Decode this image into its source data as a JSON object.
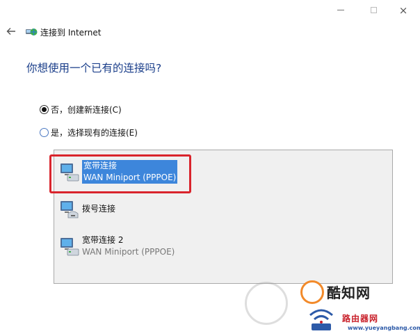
{
  "window": {
    "title": "连接到 Internet",
    "controls": {
      "minimize": "minimize-icon",
      "maximize": "maximize-icon",
      "close": "×"
    }
  },
  "page": {
    "question": "你想使用一个已有的连接吗?"
  },
  "options": [
    {
      "label": "否，创建新连接(C)",
      "checked": true
    },
    {
      "label": "是，选择现有的连接(E)",
      "checked": false
    }
  ],
  "connections": [
    {
      "name": "宽带连接",
      "device": "WAN Miniport (PPPOE)",
      "selected": true
    },
    {
      "name": "拨号连接",
      "device": "",
      "selected": false
    },
    {
      "name": "宽带连接 2",
      "device": "WAN Miniport (PPPOE)",
      "selected": false
    }
  ],
  "watermark": {
    "brand": "酷知网",
    "slogan": "路由器网",
    "url": "www.yueyangbang.com"
  },
  "colors": {
    "accent": "#1a3e8a",
    "selection": "#3d86db",
    "highlight": "#d9242c"
  }
}
